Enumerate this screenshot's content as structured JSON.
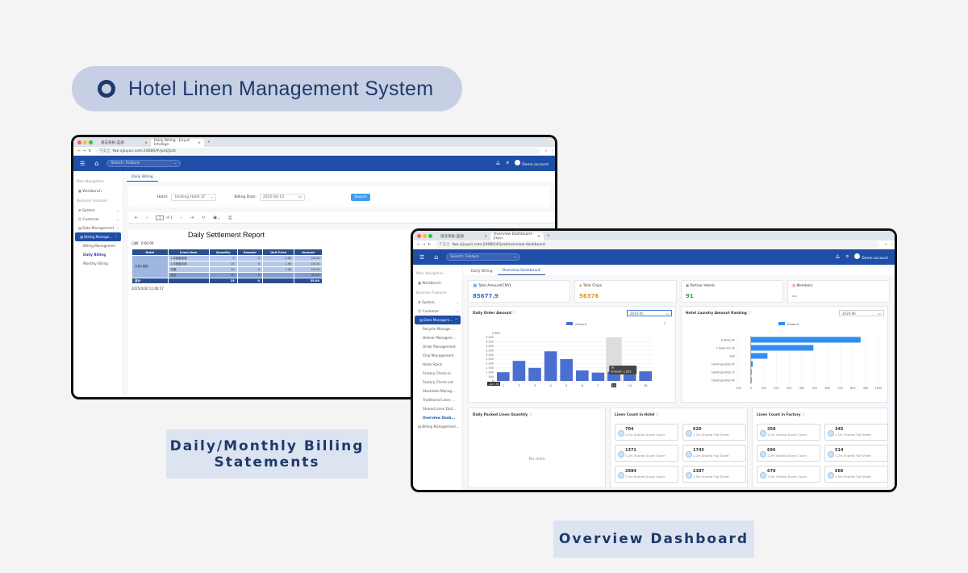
{
  "title": "Hotel Linen Management System",
  "captions": {
    "billing": "Daily/Monthly Billing\nStatements",
    "overview": "Overview Dashboard"
  },
  "billing_screen": {
    "tabs": [
      "源沃系统-蓝湖",
      "Daily Billing - Jiuyun Intellige"
    ],
    "url": "fwe.xjiuyun.com:24080/#/jxxt/jzzd",
    "secure": "不安全",
    "search_placeholder": "Search: Feature",
    "account": "Demo account",
    "sidebar": {
      "main_nav": "Main Navigation",
      "workbench": "Workbench",
      "business": "Business Features",
      "items": [
        "System",
        "Customer",
        "Data Management",
        "Billing Manage..."
      ],
      "sub": [
        "Billing Managemen",
        "Daily Billing",
        "Monthly Billing"
      ]
    },
    "subtab": "Daily Billing",
    "filter": {
      "hotel_label": "Hotel:",
      "hotel_value": "Hanting Hotel 1F",
      "date_label": "Billing Date:",
      "date_value": "2025-04-10",
      "search_btn": "Search"
    },
    "pager": {
      "page": "1",
      "of": "of 1"
    },
    "report": {
      "title": "Daily Settlement Report",
      "date_line": "日期：0:00:00",
      "headers": [
        "Hotel",
        "Linen Item",
        "Quantity",
        "Rewash",
        "Unit Price",
        "Amount"
      ],
      "hotel_cell": "汉庭1楼楼",
      "rows": [
        [
          "1.8被套被套",
          "5",
          "0",
          "2.00",
          "10.00"
        ],
        [
          "1.8被套床单",
          "10",
          "0",
          "1.50",
          "15.00"
        ],
        [
          "枕套",
          "10",
          "0",
          "1.00",
          "10.00"
        ],
        [
          "合计",
          "25",
          "0",
          "",
          "35.00"
        ]
      ],
      "total": [
        "总计",
        "25",
        "0",
        "",
        "35.00"
      ],
      "printed": "2025/4/30 11:46:57"
    }
  },
  "overview_screen": {
    "tabs": [
      "源沃系统-蓝湖",
      "Overview Dashboard - Jiuyu"
    ],
    "url": "fwe.xjiuyun.com:24080/#/jxxt/overview-dashboard",
    "secure": "不安全",
    "search_placeholder": "Search: Feature",
    "account": "Demo account",
    "sidebar": {
      "main_nav": "Main Navigation",
      "workbench": "Workbench",
      "business": "Business Features",
      "items": [
        "System",
        "Customer",
        "Data Managem..."
      ],
      "sub": [
        "Recycle Manage...",
        "Deliver Managem...",
        "Order Management",
        "Chip Management",
        "Hotel Stock",
        "Factory Check-in",
        "Factory Check-out",
        "Stocktake Manag...",
        "Traditional Linen ...",
        "Shared Linen Dail...",
        "Overview Dash..."
      ],
      "billing": "Billing Management"
    },
    "subtabs": [
      "Daily Billing",
      "Overview Dashboard"
    ],
    "stats": [
      {
        "label": "Total Amount(CNY)",
        "value": "85677.9",
        "color": "#2d6fd6"
      },
      {
        "label": "Total Chips",
        "value": "56376",
        "color": "#f08a24"
      },
      {
        "label": "Partner Hotels",
        "value": "91",
        "color": "#3aa64c"
      },
      {
        "label": "Members",
        "value": "--",
        "color": "#e0473d"
      }
    ],
    "daily_order": {
      "title": "Daily Order Amount",
      "date": "2025-05",
      "legend": "Amount",
      "unit": "(CNY)",
      "tooltip_x": "10",
      "tooltip": "Amount: 1,053",
      "pointer": "-227.76"
    },
    "ranking": {
      "title": "Hotel Laundry Amount Ranking",
      "date": "2025-06",
      "legend": "Amount"
    },
    "packed": {
      "title": "Daily Packed Linen Quantity",
      "empty": "No data"
    },
    "in_hotel": {
      "title": "Linen Count in Hotel",
      "cards": [
        [
          "704",
          "1.1m Shared Duvet Cover"
        ],
        [
          "620",
          "1.1m Shared Flat Sheet"
        ],
        [
          "1371",
          "1.2m Shared Duvet Cover"
        ],
        [
          "1745",
          "1.2m Shared Flat Sheet"
        ],
        [
          "2884",
          "1.5m Shared Duvet Cover"
        ],
        [
          "2387",
          "1.5m Shared Flat Sheet"
        ]
      ]
    },
    "in_factory": {
      "title": "Linen Count in Factory",
      "cards": [
        [
          "358",
          "1.1m Shared Duvet Cover"
        ],
        [
          "345",
          "1.1m Shared Flat Sheet"
        ],
        [
          "696",
          "1.2m Shared Duvet Cover"
        ],
        [
          "514",
          "1.2m Shared Flat Sheet"
        ],
        [
          "670",
          "1.5m Shared Duvet Cover"
        ],
        [
          "686",
          "1.5m Shared Flat Sheet"
        ]
      ]
    }
  },
  "chart_data": [
    {
      "type": "bar",
      "title": "Daily Order Amount",
      "ylabel": "(CNY)",
      "categories": [
        "1",
        "2",
        "3",
        "4",
        "5",
        "6",
        "7",
        "10",
        "14",
        "28"
      ],
      "series": [
        {
          "name": "Amount",
          "values": [
            1000,
            2300,
            1500,
            3400,
            2500,
            1200,
            950,
            1053,
            1200,
            1100
          ]
        }
      ],
      "ylim": [
        0,
        5000
      ],
      "yticks": [
        "0",
        "500",
        "1,000",
        "1,500",
        "2,000",
        "2,500",
        "3,000",
        "3,500",
        "4,000",
        "4,500",
        "5,000"
      ]
    },
    {
      "type": "bar",
      "orientation": "horizontal",
      "title": "Hotel Laundry Amount Ranking",
      "categories": [
        "JI Hotel 3F",
        "7 Days Inn 2F",
        "test",
        "Hanting Hotel 5F",
        "Hanting Hotel 1F",
        "Hanting Hotel 4F"
      ],
      "series": [
        {
          "name": "Amount",
          "values": [
            860,
            490,
            130,
            15,
            5,
            3
          ]
        }
      ],
      "xlim": [
        -100,
        1000
      ],
      "xticks": [
        "-100",
        "0",
        "100",
        "200",
        "300",
        "400",
        "500",
        "600",
        "700",
        "800",
        "900",
        "1000"
      ]
    }
  ]
}
